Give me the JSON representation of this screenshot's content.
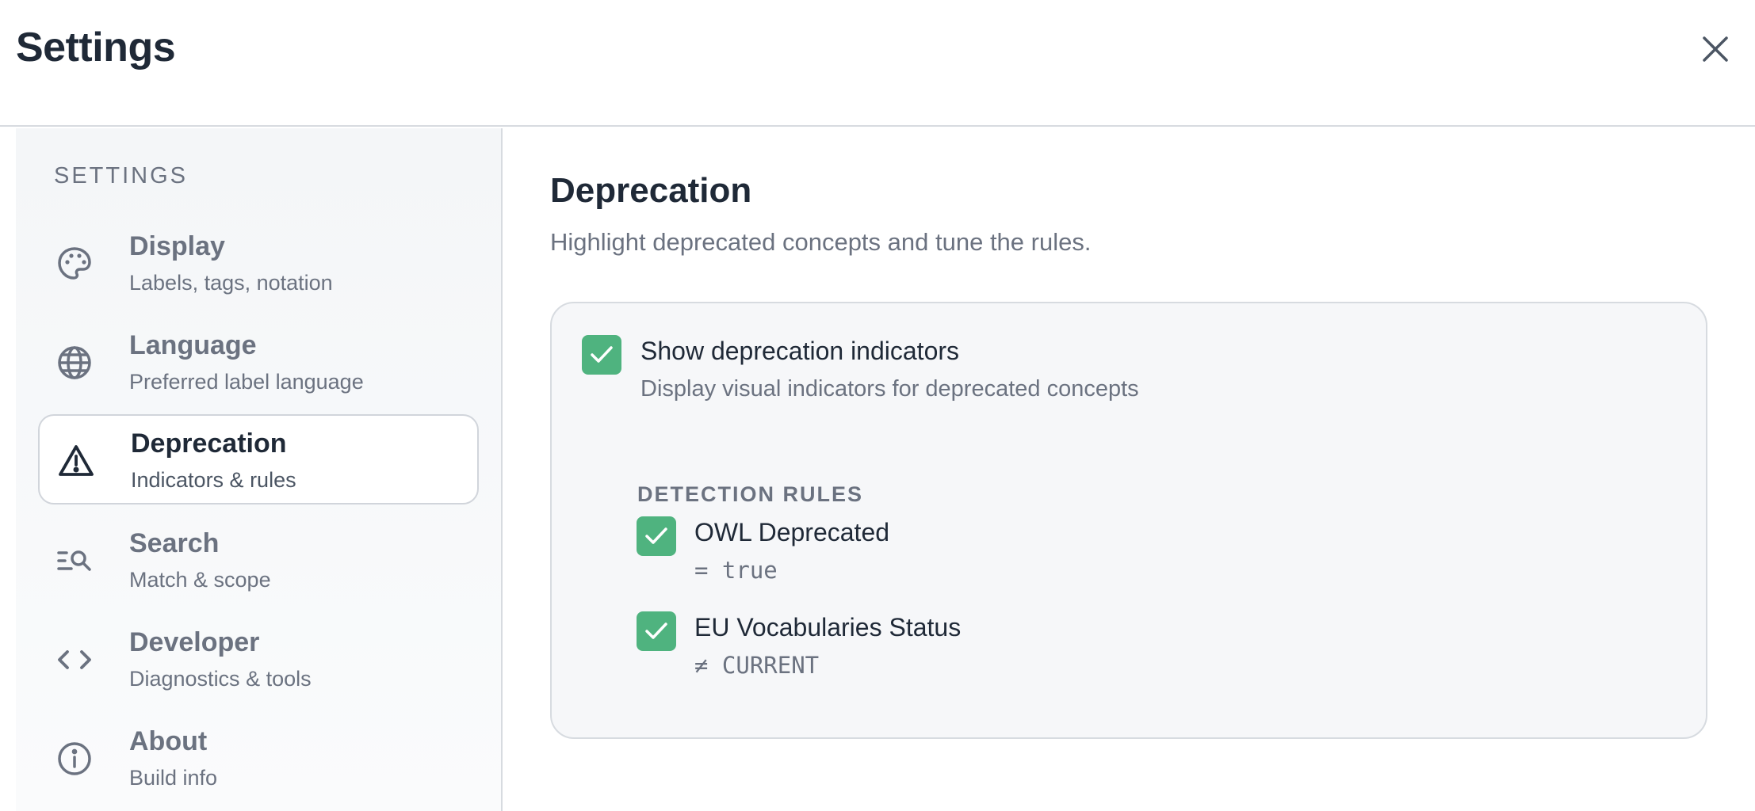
{
  "header": {
    "title": "Settings",
    "close_icon": "close-icon"
  },
  "sidebar": {
    "heading": "SETTINGS",
    "items": [
      {
        "label": "Display",
        "sub": "Labels, tags, notation",
        "icon": "palette-icon",
        "active": false
      },
      {
        "label": "Language",
        "sub": "Preferred label language",
        "icon": "globe-icon",
        "active": false
      },
      {
        "label": "Deprecation",
        "sub": "Indicators & rules",
        "icon": "warning-triangle-icon",
        "active": true
      },
      {
        "label": "Search",
        "sub": "Match & scope",
        "icon": "search-list-icon",
        "active": false
      },
      {
        "label": "Developer",
        "sub": "Diagnostics & tools",
        "icon": "code-icon",
        "active": false
      },
      {
        "label": "About",
        "sub": "Build info",
        "icon": "info-icon",
        "active": false
      }
    ]
  },
  "main": {
    "title": "Deprecation",
    "description": "Highlight deprecated concepts and tune the rules.",
    "show_indicators": {
      "label": "Show deprecation indicators",
      "sub": "Display visual indicators for deprecated concepts",
      "checked": true
    },
    "rules_heading": "DETECTION RULES",
    "rules": [
      {
        "label": "OWL Deprecated",
        "condition": "= true",
        "checked": true
      },
      {
        "label": "EU Vocabularies Status",
        "condition": "≠ CURRENT",
        "checked": true
      }
    ]
  },
  "colors": {
    "accent_green": "#4fb37f",
    "text_primary": "#1f2937",
    "text_muted": "#6b7280",
    "border": "#d7dbe0"
  }
}
